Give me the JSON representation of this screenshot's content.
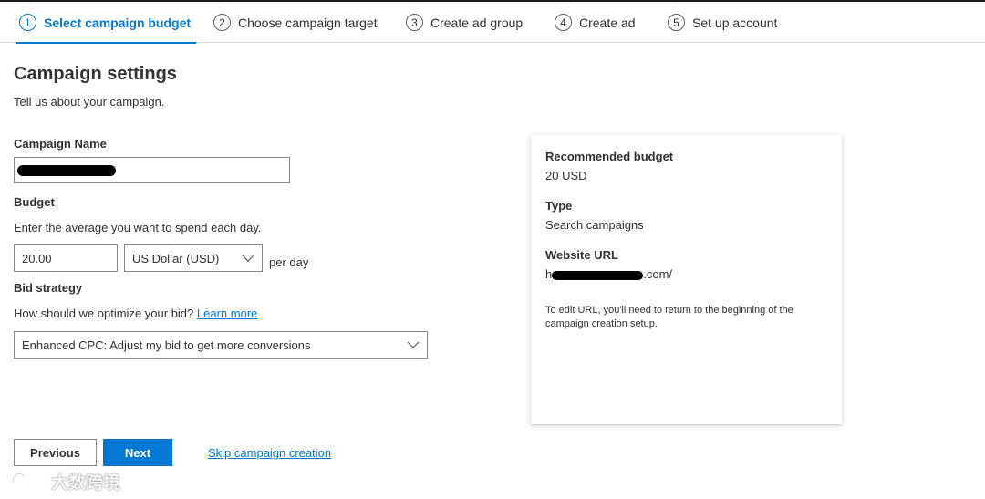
{
  "steps": [
    {
      "num": "1",
      "label": "Select campaign budget",
      "active": true
    },
    {
      "num": "2",
      "label": "Choose campaign target"
    },
    {
      "num": "3",
      "label": "Create ad group"
    },
    {
      "num": "4",
      "label": "Create ad"
    },
    {
      "num": "5",
      "label": "Set up account"
    }
  ],
  "page": {
    "title": "Campaign settings",
    "subtitle": "Tell us about your campaign."
  },
  "form": {
    "campaign_name_label": "Campaign Name",
    "campaign_name_value": "",
    "budget_label": "Budget",
    "budget_help": "Enter the average you want to spend each day.",
    "budget_value": "20.00",
    "currency_selected": "US Dollar (USD)",
    "per_day": "per day",
    "bid_label": "Bid strategy",
    "bid_help": "How should we optimize your bid?",
    "bid_learn_more": "Learn more",
    "bid_selected": "Enhanced CPC: Adjust my bid to get more conversions"
  },
  "summary": {
    "recommended_budget_label": "Recommended budget",
    "recommended_budget_value": "20  USD",
    "type_label": "Type",
    "type_value": "Search campaigns",
    "website_label": "Website URL",
    "website_prefix": "h",
    "website_suffix": ".com/",
    "note": "To edit URL, you'll need to return to the beginning of the campaign creation setup."
  },
  "actions": {
    "previous": "Previous",
    "next": "Next",
    "skip": "Skip campaign creation"
  },
  "watermark": {
    "text": "大数跨境"
  },
  "colors": {
    "accent": "#0078d4",
    "text": "#323130",
    "border": "#8a8886"
  }
}
